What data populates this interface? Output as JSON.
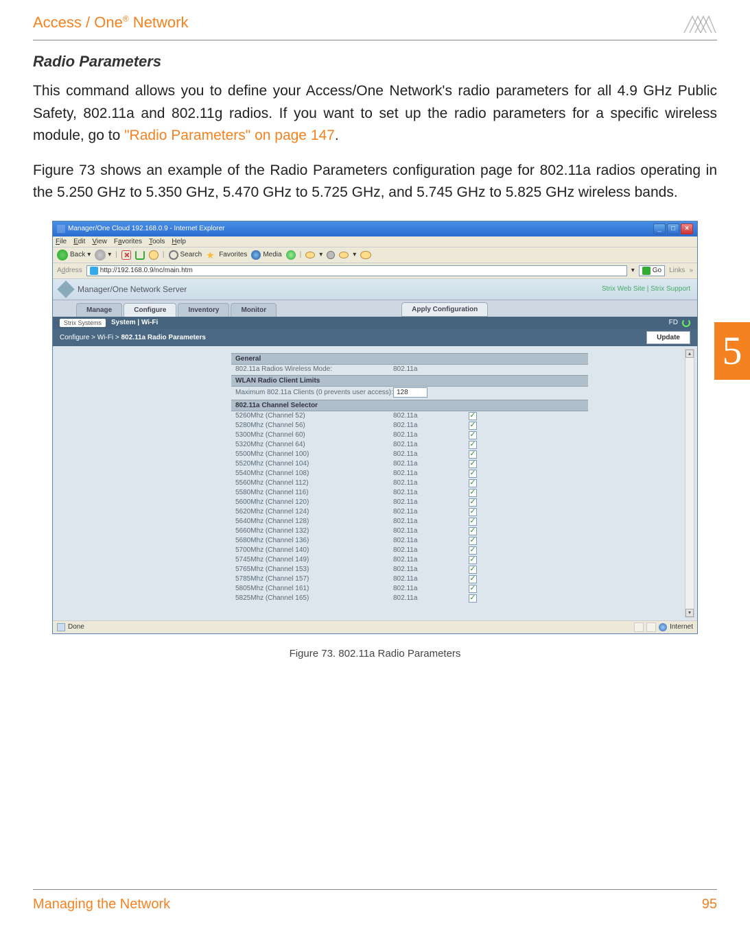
{
  "header": {
    "brand_pre": "Access / One",
    "brand_sup": "®",
    "brand_post": " Network"
  },
  "section": {
    "heading": "Radio Parameters",
    "para1_a": "This command allows you to define your Access/One Network's radio parameters for all 4.9 GHz Public Safety, 802.11a and 802.11g radios. If you want to set up the radio parameters for a specific wireless module, go to ",
    "para1_link": "\"Radio Parameters\" on page 147",
    "para1_b": ".",
    "para2": "Figure 73 shows an example of the Radio Parameters configuration page for 802.11a radios operating in the 5.250 GHz to 5.350 GHz, 5.470 GHz to 5.725 GHz, and 5.745 GHz to 5.825 GHz wireless bands."
  },
  "browser": {
    "title": "Manager/One Cloud 192.168.0.9 - Internet Explorer",
    "menus": [
      "File",
      "Edit",
      "View",
      "Favorites",
      "Tools",
      "Help"
    ],
    "toolbar": {
      "back": "Back",
      "search": "Search",
      "favorites": "Favorites",
      "media": "Media"
    },
    "address_label": "Address",
    "url": "http://192.168.0.9/nc/main.htm",
    "go": "Go",
    "links": "Links"
  },
  "app": {
    "title": "Manager/One Network Server",
    "header_links": "Strix Web Site  |  Strix Support",
    "tabs": [
      "Manage",
      "Configure",
      "Inventory",
      "Monitor"
    ],
    "apply": "Apply Configuration",
    "subnav_pill": "Strix Systems",
    "subnav_text": "System  |  Wi-Fi",
    "subnav_right": "FD",
    "breadcrumb_pre": "Configure > Wi-Fi > ",
    "breadcrumb_bold": "802.11a Radio Parameters",
    "update": "Update"
  },
  "config": {
    "general_head": "General",
    "general_row": {
      "label": "802.11a Radios Wireless Mode:",
      "value": "802.11a"
    },
    "limits_head": "WLAN Radio Client Limits",
    "limits_row": {
      "label": "Maximum 802.11a Clients (0 prevents user access):",
      "value": "128"
    },
    "selector_head": "802.11a Channel Selector",
    "channels": [
      {
        "label": "5260Mhz (Channel 52)",
        "value": "802.11a",
        "checked": true
      },
      {
        "label": "5280Mhz (Channel 56)",
        "value": "802.11a",
        "checked": true
      },
      {
        "label": "5300Mhz (Channel 60)",
        "value": "802.11a",
        "checked": true
      },
      {
        "label": "5320Mhz (Channel 64)",
        "value": "802.11a",
        "checked": true
      },
      {
        "label": "5500Mhz (Channel 100)",
        "value": "802.11a",
        "checked": true
      },
      {
        "label": "5520Mhz (Channel 104)",
        "value": "802.11a",
        "checked": true
      },
      {
        "label": "5540Mhz (Channel 108)",
        "value": "802.11a",
        "checked": true
      },
      {
        "label": "5560Mhz (Channel 112)",
        "value": "802.11a",
        "checked": true
      },
      {
        "label": "5580Mhz (Channel 116)",
        "value": "802.11a",
        "checked": true
      },
      {
        "label": "5600Mhz (Channel 120)",
        "value": "802.11a",
        "checked": true
      },
      {
        "label": "5620Mhz (Channel 124)",
        "value": "802.11a",
        "checked": true
      },
      {
        "label": "5640Mhz (Channel 128)",
        "value": "802.11a",
        "checked": true
      },
      {
        "label": "5660Mhz (Channel 132)",
        "value": "802.11a",
        "checked": true
      },
      {
        "label": "5680Mhz (Channel 136)",
        "value": "802.11a",
        "checked": true
      },
      {
        "label": "5700Mhz (Channel 140)",
        "value": "802.11a",
        "checked": true
      },
      {
        "label": "5745Mhz (Channel 149)",
        "value": "802.11a",
        "checked": true
      },
      {
        "label": "5765Mhz (Channel 153)",
        "value": "802.11a",
        "checked": true
      },
      {
        "label": "5785Mhz (Channel 157)",
        "value": "802.11a",
        "checked": true
      },
      {
        "label": "5805Mhz (Channel 161)",
        "value": "802.11a",
        "checked": true
      },
      {
        "label": "5825Mhz (Channel 165)",
        "value": "802.11a",
        "checked": true
      }
    ]
  },
  "statusbar": {
    "left": "Done",
    "right": "Internet"
  },
  "figure_caption": "Figure 73. 802.11a Radio Parameters",
  "footer": {
    "left": "Managing the Network",
    "right": "95"
  },
  "side_tab": "5"
}
